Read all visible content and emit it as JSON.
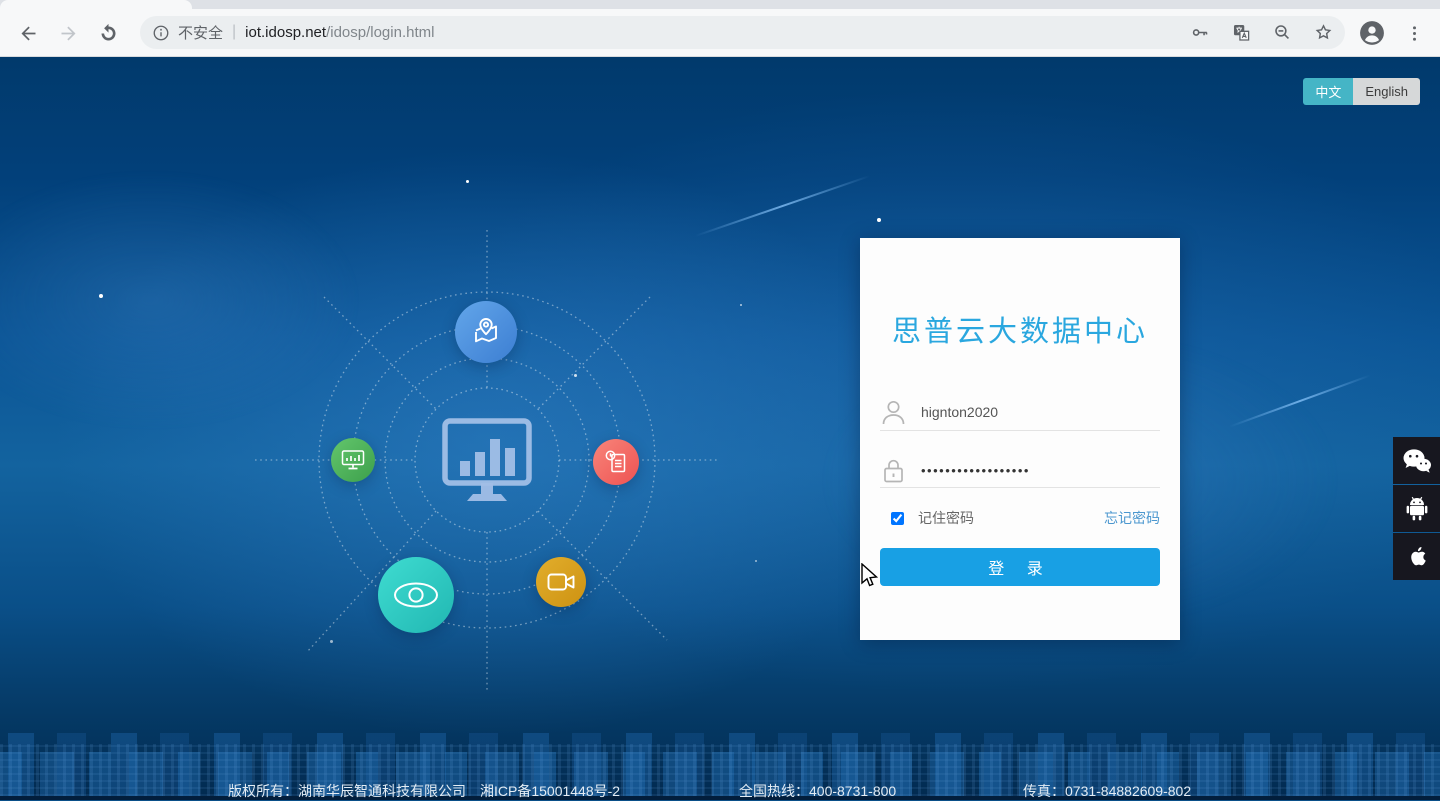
{
  "browser": {
    "address": {
      "security_label": "不安全",
      "divider": "|",
      "host": "iot.idosp.net",
      "path": "/idosp/login.html"
    },
    "icons": [
      "back-icon",
      "forward-icon",
      "reload-icon",
      "info-icon",
      "key-icon",
      "translate-icon",
      "zoom-out-icon",
      "star-icon",
      "profile-icon",
      "browser-menu-icon"
    ]
  },
  "language_toggle": {
    "chinese_label": "中文",
    "english_label": "English",
    "active": "中文",
    "active_color": "#45b5c6"
  },
  "hub": {
    "icons": [
      "map-pin-icon",
      "dashboard-monitor-icon",
      "screen-chart-icon",
      "report-clock-icon",
      "eye-icon",
      "video-camera-icon"
    ]
  },
  "login": {
    "title": "思普云大数据中心",
    "title_color": "#2aa7df",
    "username_value": "hignton2020",
    "password_masked": "••••••••••••••••••",
    "remember_checked": true,
    "remember_label": "记住密码",
    "forgot_label": "忘记密码",
    "submit_label": "登 录",
    "button_color": "#18a0e4"
  },
  "app_links": {
    "icons": [
      "wechat-icon",
      "android-icon",
      "apple-icon"
    ]
  },
  "footer": {
    "copyright": "版权所有：湖南华辰智通科技有限公司　湘ICP备15001448号-2",
    "hotline": "全国热线：400-8731-800",
    "fax": "传真：0731-84882609-802"
  }
}
